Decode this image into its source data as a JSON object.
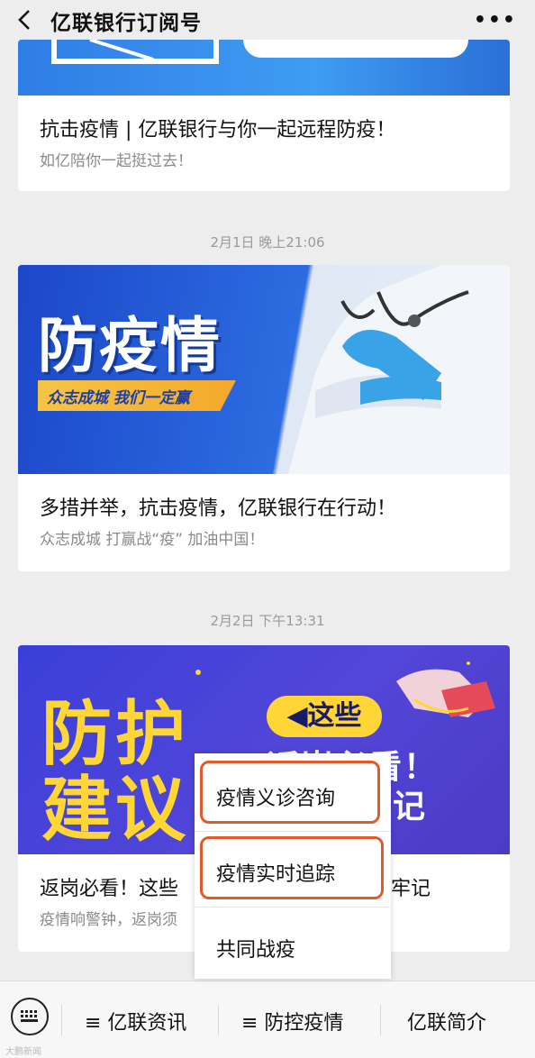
{
  "header": {
    "title": "亿联银行订阅号",
    "back_icon": "chevron-left-icon",
    "more_label": "•••"
  },
  "articles": [
    {
      "title": "抗击疫情 | 亿联银行与你一起远程防疫！",
      "subtitle": "如亿陪你一起挺过去！"
    },
    {
      "timestamp": "2月1日 晚上21:06",
      "banner_title": "防疫情",
      "banner_slogan": "众志成城  我们一定赢",
      "title": "多措并举，抗击疫情，亿联银行在行动！",
      "subtitle": "众志成城 打赢战“疫” 加油中国！"
    },
    {
      "timestamp": "2月2日 下午13:31",
      "banner_line1": "防护",
      "banner_line2": "建议",
      "banner_pill": "◀这些",
      "banner_text2": "返岗必看！",
      "banner_text3": "牢记",
      "title_left": "返岗必看！这些",
      "title_right": "牢记",
      "subtitle": "疫情响警钟，返岗须"
    }
  ],
  "menu": {
    "items": [
      {
        "label": "疫情义诊咨询",
        "highlighted": true
      },
      {
        "label": "疫情实时追踪",
        "highlighted": true
      },
      {
        "label": "共同战疫",
        "highlighted": false
      }
    ],
    "highlight_color": "#e05a2b"
  },
  "bottom_bar": {
    "keyboard_icon": "keyboard-icon",
    "tabs": [
      "≡ 亿联资讯",
      "≡ 防控疫情",
      "亿联简介"
    ]
  },
  "watermark": "大鹏新闻"
}
